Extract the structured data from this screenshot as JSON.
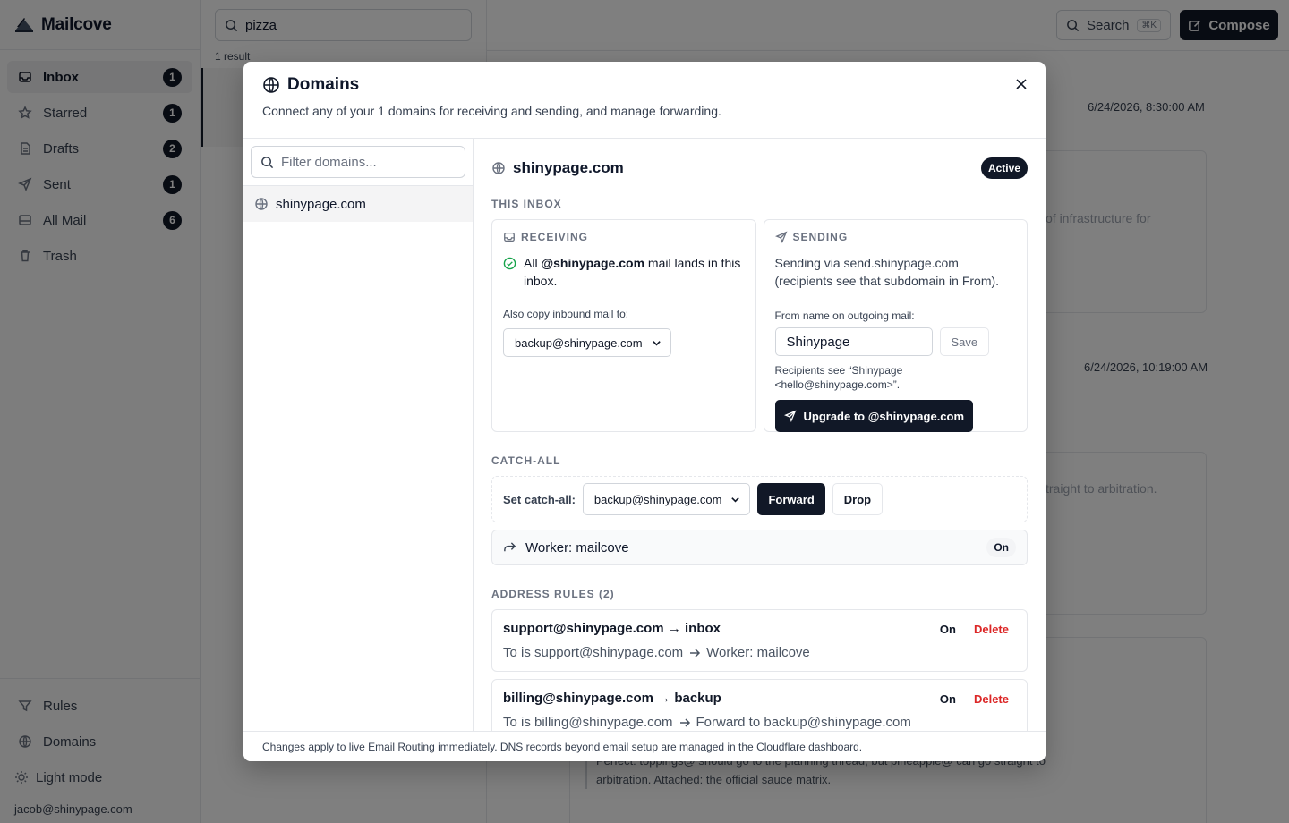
{
  "app": {
    "name": "Mailcove",
    "nav": [
      {
        "label": "Inbox",
        "count": "1",
        "icon": "inbox-icon"
      },
      {
        "label": "Starred",
        "count": "1",
        "icon": "star-icon"
      },
      {
        "label": "Drafts",
        "count": "2",
        "icon": "file-icon"
      },
      {
        "label": "Sent",
        "count": "1",
        "icon": "send-icon"
      },
      {
        "label": "All Mail",
        "count": "6",
        "icon": "mail-icon"
      },
      {
        "label": "Trash",
        "count": "",
        "icon": "trash-icon"
      }
    ],
    "bottom_nav": {
      "rules": "Rules",
      "domains": "Domains",
      "theme": "Light mode"
    },
    "user_email": "jacob@shinypage.com"
  },
  "list": {
    "search_value": "pizza",
    "result_count": "1 result"
  },
  "toolbar": {
    "search_label": "Search",
    "search_shortcut": "⌘K",
    "compose_label": "Compose"
  },
  "thread": {
    "dates": [
      "6/24/2026, 8:30:00 AM",
      "6/24/2026, 10:19:00 AM"
    ],
    "snippet_1": "of infrastructure for",
    "snippet_2": "traight to arbitration.",
    "quote": "Perfect: toppings@ should go to the planning thread, but pineapple@ can go straight to arbitration. Attached: the official sauce matrix."
  },
  "modal": {
    "title": "Domains",
    "description": "Connect any of your 1 domains for receiving and sending, and manage forwarding.",
    "filter_placeholder": "Filter domains...",
    "domains": [
      "shinypage.com"
    ],
    "selected": {
      "domain": "shinypage.com",
      "status": "Active",
      "this_inbox_label": "This Inbox",
      "receiving": {
        "label": "RECEIVING",
        "line_prefix": "All ",
        "line_domain": "@shinypage.com",
        "line_suffix": " mail lands in this inbox.",
        "copy_label": "Also copy inbound mail to:",
        "copy_value": "backup@shinypage.com"
      },
      "sending": {
        "label": "SENDING",
        "text": "Sending via send.shinypage.com (recipients see that subdomain in From).",
        "from_label": "From name on outgoing mail:",
        "from_value": "Shinypage",
        "save_label": "Save",
        "recipients_note": "Recipients see “Shinypage <hello@shinypage.com>”.",
        "upgrade_label": "Upgrade to @shinypage.com"
      },
      "catch_all": {
        "label": "Catch-All",
        "set_label": "Set catch-all:",
        "value": "backup@shinypage.com",
        "forward_label": "Forward",
        "drop_label": "Drop",
        "worker_label": "Worker: mailcove",
        "worker_status": "On"
      },
      "address_rules": {
        "label": "Address Rules (2)",
        "rules": [
          {
            "title": "support@shinypage.com → inbox",
            "condition": "To is support@shinypage.com",
            "action": "Worker: mailcove",
            "status": "On",
            "delete": "Delete"
          },
          {
            "title": "billing@shinypage.com → backup",
            "condition": "To is billing@shinypage.com",
            "action": "Forward to backup@shinypage.com",
            "status": "On",
            "delete": "Delete"
          }
        ]
      }
    },
    "footer": "Changes apply to live Email Routing immediately. DNS records beyond email setup are managed in the Cloudflare dashboard."
  }
}
